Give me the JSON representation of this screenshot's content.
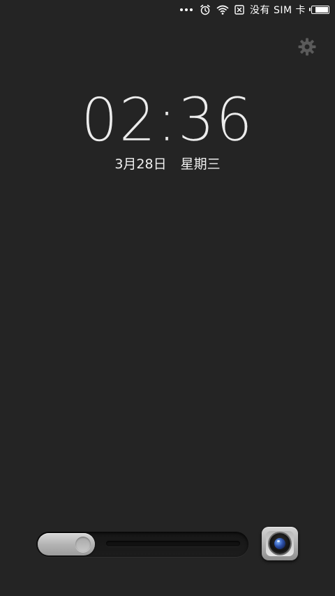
{
  "status_bar": {
    "sim_status": "没有 SIM 卡",
    "icons": [
      "more-dots-icon",
      "alarm-icon",
      "wifi-icon",
      "no-sim-icon",
      "battery-icon"
    ],
    "battery_level": 0.85
  },
  "lock_screen": {
    "time": "02:36",
    "date": "3月28日",
    "weekday": "星期三"
  },
  "controls": {
    "settings_icon": "gear-icon",
    "unlock_handle_icon": "slider-knob-icon",
    "camera_icon": "camera-lens-icon"
  },
  "colors": {
    "background": "#242424",
    "text": "#e8e8e8",
    "handle": "#b4b4b4",
    "camera_lens": "#2b4fa8"
  }
}
